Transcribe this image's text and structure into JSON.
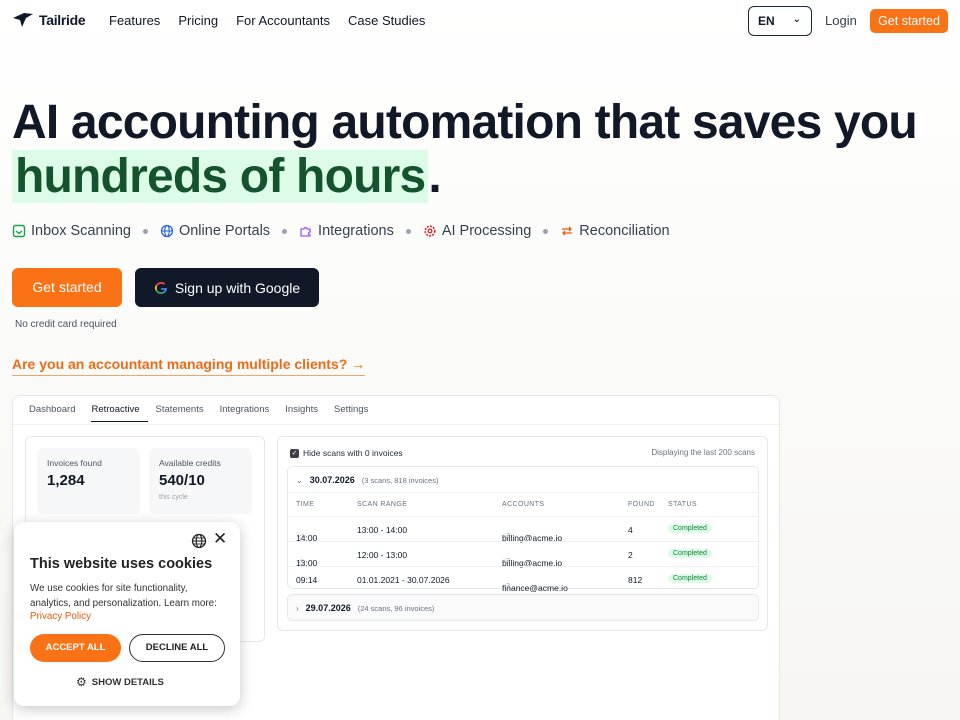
{
  "nav": {
    "brand": "Tailride",
    "links": [
      "Features",
      "Pricing",
      "For Accountants",
      "Case Studies"
    ],
    "language": "EN",
    "login": "Login",
    "cta": "Get started"
  },
  "hero": {
    "title_line1": "AI accounting automation that saves you",
    "title_highlight": "hundreds of hours",
    "title_end": ".",
    "features": [
      {
        "label": "Inbox Scanning",
        "icon": "inbox-icon"
      },
      {
        "label": "Online Portals",
        "icon": "globe-icon"
      },
      {
        "label": "Integrations",
        "icon": "puzzle-icon"
      },
      {
        "label": "AI Processing",
        "icon": "cog-icon"
      },
      {
        "label": "Reconciliation",
        "icon": "swap-icon"
      }
    ],
    "primary_cta": "Get started",
    "google_cta": "Sign up with Google",
    "note": "No credit card required",
    "accountant_link": "Are you an accountant managing multiple clients? →"
  },
  "app": {
    "tabs": [
      "Dashboard",
      "Retroactive",
      "Statements",
      "Integrations",
      "Insights",
      "Settings"
    ],
    "active_tab": "Retroactive",
    "stats": [
      {
        "label": "Invoices found",
        "value": "1,284",
        "sub": ""
      },
      {
        "label": "Available credits",
        "value": "540/10",
        "sub": "this cycle"
      }
    ],
    "hide_scans_label": "Hide scans with 0 invoices",
    "displaying": "Displaying the last 200 scans",
    "group1": {
      "date": "30.07.2026",
      "meta": "(3 scans, 818 invoices)"
    },
    "columns": [
      "TIME",
      "SCAN RANGE",
      "ACCOUNTS",
      "FOUND",
      "STATUS"
    ],
    "rows": [
      {
        "time": "14:00",
        "range": "13:00 - 14:00",
        "account": "billing@acme.io",
        "extra": "+3",
        "found": "4",
        "status": "Completed"
      },
      {
        "time": "13:00",
        "range": "12:00 - 13:00",
        "account": "billing@acme.io",
        "extra": "+3",
        "found": "2",
        "status": "Completed"
      },
      {
        "time": "09:14",
        "range": "01.01.2021 - 30.07.2026",
        "account": "finance@acme.io",
        "extra": "+3",
        "found": "812",
        "status": "Completed"
      }
    ],
    "group2": {
      "date": "29.07.2026",
      "meta": "(24 scans, 96 invoices)"
    }
  },
  "cookie": {
    "title": "This website uses cookies",
    "text": "We use cookies for site functionality, analytics, and personalization. Learn more:",
    "link": "Privacy Policy",
    "accept": "ACCEPT ALL",
    "decline": "DECLINE ALL",
    "details": "SHOW DETAILS"
  },
  "colors": {
    "accent": "#f97316",
    "dark": "#111827",
    "highlight_bg": "#dcfce7",
    "highlight_text": "#14532d"
  }
}
